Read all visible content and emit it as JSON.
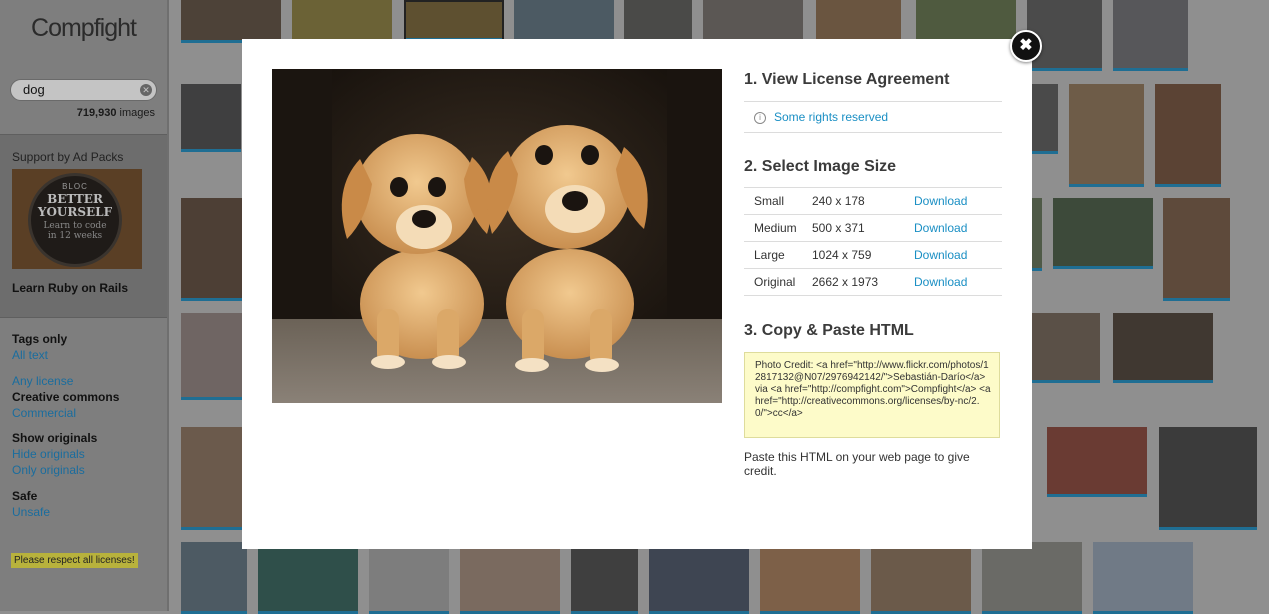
{
  "app": {
    "name": "Compfight"
  },
  "search": {
    "query": "dog",
    "result_count": "719,930",
    "result_unit": "images"
  },
  "ads": {
    "label": "Support by Ad Packs",
    "banner": {
      "brand": "BLOC",
      "headline_1": "BETTER",
      "headline_2": "YOURSELF",
      "sub_1": "Learn to code",
      "sub_2": "in 12 weeks"
    },
    "caption": "Learn Ruby on Rails"
  },
  "filters": {
    "tags_only": "Tags only",
    "all_text": "All text",
    "any_license": "Any license",
    "creative_commons": "Creative commons",
    "commercial": "Commercial",
    "show_originals": "Show originals",
    "hide_originals": "Hide originals",
    "only_originals": "Only originals",
    "safe": "Safe",
    "unsafe": "Unsafe"
  },
  "notice": "Please respect all licenses!",
  "modal": {
    "close_icon": "close-x-icon",
    "section1_title": "1. View License Agreement",
    "license_text": "Some rights reserved",
    "section2_title": "2. Select Image Size",
    "sizes": [
      {
        "name": "Small",
        "dims": "240 x 178",
        "action": "Download"
      },
      {
        "name": "Medium",
        "dims": "500 x 371",
        "action": "Download"
      },
      {
        "name": "Large",
        "dims": "1024 x 759",
        "action": "Download"
      },
      {
        "name": "Original",
        "dims": "2662 x 1973",
        "action": "Download"
      }
    ],
    "section3_title": "3. Copy & Paste HTML",
    "html_snippet": "Photo Credit: <a href=\"http://www.flickr.com/photos/12817132@N07/2976942142/\">Sebastián-Darío</a> via <a href=\"http://compfight.com\">Compfight</a> <a href=\"http://creativecommons.org/licenses/by-nc/2.0/\">cc</a>",
    "paste_note": "Paste this HTML on your web page to give credit."
  },
  "colors": {
    "link": "#1a8fc4",
    "overlay": "#8f8f8f",
    "snippet_bg": "#fdfbc9",
    "thumb_underline": "#1f6e93"
  }
}
